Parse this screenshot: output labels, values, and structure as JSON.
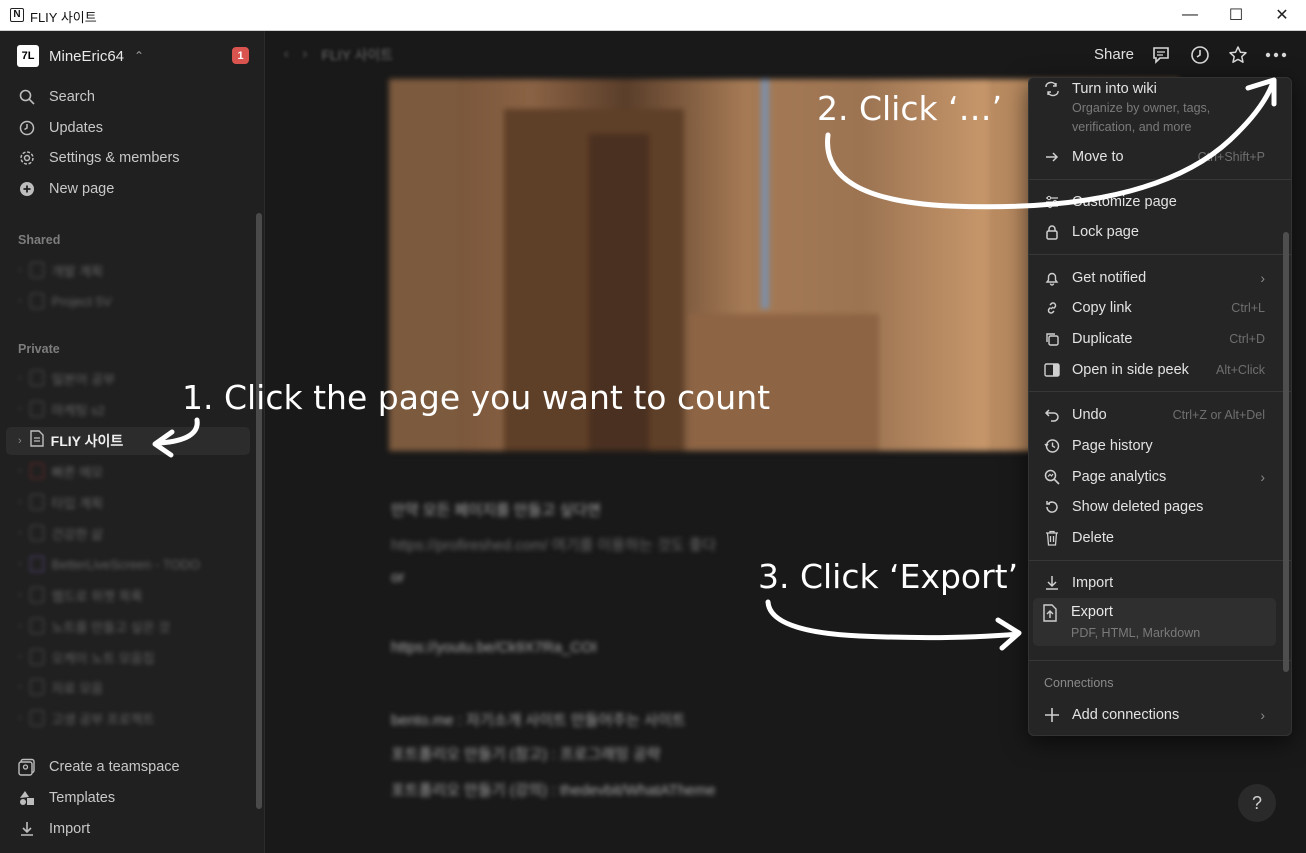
{
  "window": {
    "title": "FLIY 사이트",
    "app_icon": "N",
    "controls": {
      "minimize": "—",
      "maximize": "☐",
      "close": "✕"
    }
  },
  "sidebar": {
    "workspace": {
      "logo": "7L",
      "name": "MineEric64",
      "badge": "1"
    },
    "nav": [
      {
        "label": "Search",
        "icon": "search-icon"
      },
      {
        "label": "Updates",
        "icon": "clock-icon"
      },
      {
        "label": "Settings & members",
        "icon": "gear-icon"
      },
      {
        "label": "New page",
        "icon": "plus-circle-icon"
      }
    ],
    "shared_label": "Shared",
    "shared_items": [
      "개발 계획",
      "Project 5V"
    ],
    "private_label": "Private",
    "private_items_before": [
      "일본어 공부",
      "마케팅 s2"
    ],
    "active_item": "FLIY 사이트",
    "private_items_after": [
      "빠른 메모",
      "타입 계획",
      "건강한 삶",
      "BetterLiveScreen - TODO",
      "웹드로 위젯 목록",
      "노트를 만들고 싶은 것",
      "오케이 노트 모음집",
      "자료 모음",
      "고생 공부 프로젝트"
    ],
    "footer": [
      {
        "label": "Create a teamspace",
        "icon": "teamspace-icon"
      },
      {
        "label": "Templates",
        "icon": "templates-icon"
      },
      {
        "label": "Import",
        "icon": "import-icon"
      }
    ]
  },
  "topbar": {
    "breadcrumb": "FLIY 사이트",
    "share_label": "Share"
  },
  "content_blurred": [
    "만약 모든 페이지를 만들고 싶다면",
    "https://profireshed.com/ 여기를 이용하는 것도 좋다",
    "or",
    "https://youtu.be/Ck9X7Ra_COI",
    "bento.me : 자기소개 사이트 만들어주는 사이트",
    "포트폴리오 만들기 (참고) : 프로그래밍 공략",
    "포트폴리오 만들기 (강의) : thedevbit/WhatATheme"
  ],
  "menu": {
    "items": [
      {
        "label": "Turn into wiki",
        "icon": "wiki-icon",
        "sub1": "Organize by owner, tags,",
        "sub2": "verification, and more"
      },
      {
        "label": "Move to",
        "icon": "arrow-right-icon",
        "shortcut": "Ctrl+Shift+P"
      },
      {
        "label": "Customize page",
        "icon": "sliders-icon"
      },
      {
        "label": "Lock page",
        "icon": "lock-icon"
      },
      {
        "label": "Get notified",
        "icon": "bell-icon",
        "arrow": "›"
      },
      {
        "label": "Copy link",
        "icon": "link-icon",
        "shortcut": "Ctrl+L"
      },
      {
        "label": "Duplicate",
        "icon": "duplicate-icon",
        "shortcut": "Ctrl+D"
      },
      {
        "label": "Open in side peek",
        "icon": "side-peek-icon",
        "shortcut": "Alt+Click"
      },
      {
        "label": "Undo",
        "icon": "undo-icon",
        "shortcut": "Ctrl+Z or Alt+Del"
      },
      {
        "label": "Page history",
        "icon": "history-icon"
      },
      {
        "label": "Page analytics",
        "icon": "analytics-icon",
        "arrow": "›"
      },
      {
        "label": "Show deleted pages",
        "icon": "restore-icon"
      },
      {
        "label": "Delete",
        "icon": "trash-icon"
      },
      {
        "label": "Import",
        "icon": "import-icon"
      },
      {
        "label": "Export",
        "icon": "export-icon",
        "sub1": "PDF, HTML, Markdown"
      },
      {
        "label": "Add connections",
        "icon": "plus-icon",
        "arrow": "›"
      }
    ],
    "connections_label": "Connections"
  },
  "annotations": {
    "step1": "1. Click the page you want to count",
    "step2": "2. Click ‘…’",
    "step3": "3. Click ‘Export’"
  },
  "help": "?"
}
